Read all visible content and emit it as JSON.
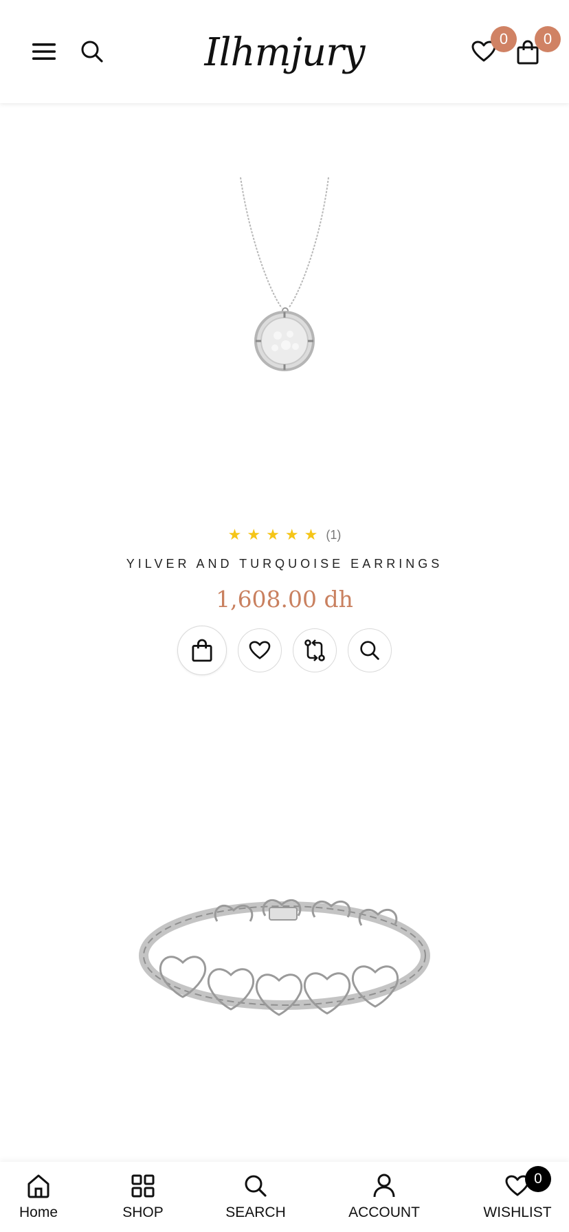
{
  "header": {
    "logo_text": "Ilhmjury",
    "wishlist_count": "0",
    "cart_count": "0",
    "icons": [
      "menu-icon",
      "search-icon",
      "heart-icon",
      "shopping-bag-icon"
    ]
  },
  "products": [
    {
      "image": "silver-coin-pendant-necklace",
      "rating_count": "(1)",
      "title": "YILVER AND TURQUOISE EARRINGS",
      "price": "1,608.00 dh",
      "actions": [
        "add-to-cart",
        "add-to-wishlist",
        "compare",
        "quick-view"
      ]
    },
    {
      "image": "silver-heart-link-bracelet"
    }
  ],
  "bottom_nav": {
    "items": [
      {
        "label": "Home",
        "icon": "home-icon"
      },
      {
        "label": "SHOP",
        "icon": "grid-icon"
      },
      {
        "label": "SEARCH",
        "icon": "search-icon"
      },
      {
        "label": "ACCOUNT",
        "icon": "user-icon"
      },
      {
        "label": "WISHLIST",
        "icon": "heart-icon"
      }
    ],
    "wishlist_count": "0"
  },
  "colors": {
    "accent": "#d08264",
    "price": "#c9805f",
    "star": "#f5c518"
  }
}
